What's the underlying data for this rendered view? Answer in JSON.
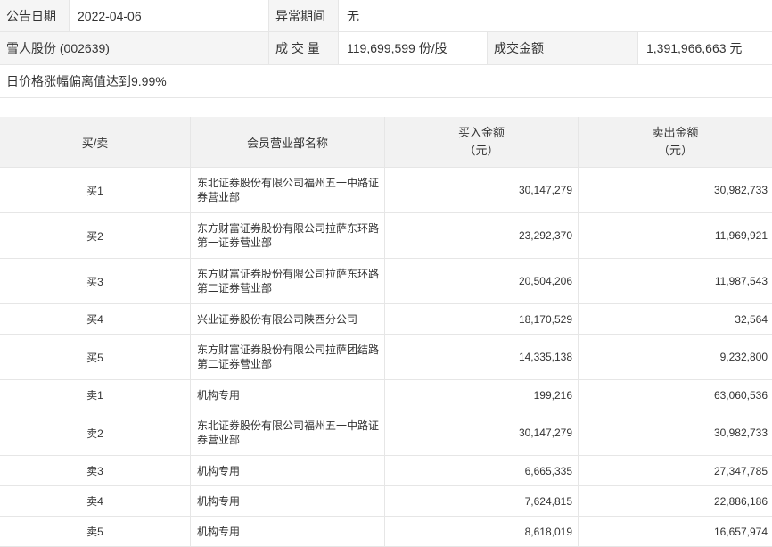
{
  "info": {
    "announce_date_label": "公告日期",
    "announce_date": "2022-04-06",
    "abnormal_period_label": "异常期间",
    "abnormal_period": "无",
    "stock": "雪人股份 (002639)",
    "volume_label": "成 交 量",
    "volume": "119,699,599 份/股",
    "turnover_label": "成交金额",
    "turnover": "1,391,966,663 元",
    "reason": "日价格涨幅偏离值达到9.99%"
  },
  "table": {
    "header": {
      "side": "买/卖",
      "branch": "会员营业部名称",
      "buy": "买入金额",
      "buy_unit": "（元）",
      "sell": "卖出金额",
      "sell_unit": "（元）"
    },
    "rows": [
      {
        "side": "买1",
        "branch": "东北证券股份有限公司福州五一中路证券营业部",
        "buy": "30,147,279",
        "sell": "30,982,733"
      },
      {
        "side": "买2",
        "branch": "东方财富证券股份有限公司拉萨东环路第一证券营业部",
        "buy": "23,292,370",
        "sell": "11,969,921"
      },
      {
        "side": "买3",
        "branch": "东方财富证券股份有限公司拉萨东环路第二证券营业部",
        "buy": "20,504,206",
        "sell": "11,987,543"
      },
      {
        "side": "买4",
        "branch": "兴业证券股份有限公司陕西分公司",
        "buy": "18,170,529",
        "sell": "32,564"
      },
      {
        "side": "买5",
        "branch": "东方财富证券股份有限公司拉萨团结路第二证券营业部",
        "buy": "14,335,138",
        "sell": "9,232,800"
      },
      {
        "side": "卖1",
        "branch": "机构专用",
        "buy": "199,216",
        "sell": "63,060,536"
      },
      {
        "side": "卖2",
        "branch": "东北证券股份有限公司福州五一中路证券营业部",
        "buy": "30,147,279",
        "sell": "30,982,733"
      },
      {
        "side": "卖3",
        "branch": "机构专用",
        "buy": "6,665,335",
        "sell": "27,347,785"
      },
      {
        "side": "卖4",
        "branch": "机构专用",
        "buy": "7,624,815",
        "sell": "22,886,186"
      },
      {
        "side": "卖5",
        "branch": "机构专用",
        "buy": "8,618,019",
        "sell": "16,657,974"
      }
    ]
  },
  "colors": {
    "text": "#333333",
    "border": "#e6e6e6",
    "label_bg": "#f5f5f5",
    "value_bg": "#ffffff",
    "header_bg": "#f2f2f2",
    "row_bg": "#ffffff"
  }
}
